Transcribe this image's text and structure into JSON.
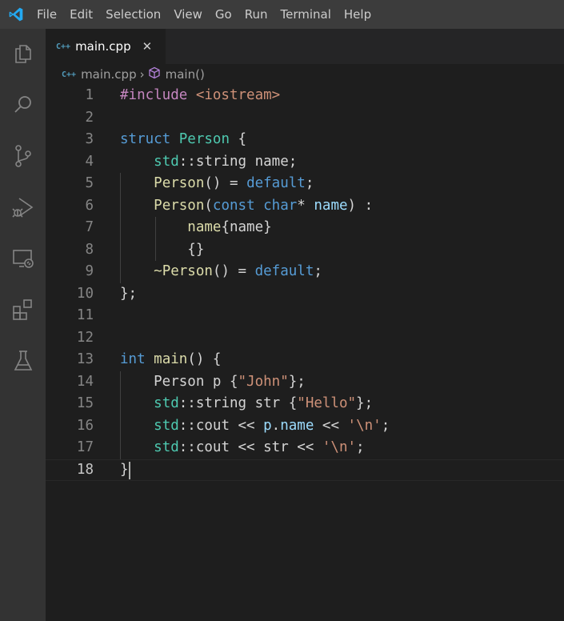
{
  "menu": [
    "File",
    "Edit",
    "Selection",
    "View",
    "Go",
    "Run",
    "Terminal",
    "Help"
  ],
  "tab": {
    "icon_text": "C++",
    "label": "main.cpp",
    "close": "✕"
  },
  "breadcrumb": {
    "icon_text": "C++",
    "file": "main.cpp",
    "separator": "›",
    "symbol": "main()"
  },
  "colors": {
    "accent": "#007acc",
    "type": "#4ec9b0",
    "keyword": "#569cd6",
    "string": "#ce9178"
  },
  "code": [
    {
      "n": "1",
      "tokens": [
        [
          "#include ",
          "kw-purple"
        ],
        [
          "<iostream>",
          "str"
        ]
      ]
    },
    {
      "n": "2",
      "tokens": []
    },
    {
      "n": "3",
      "tokens": [
        [
          "struct ",
          "kw-blue"
        ],
        [
          "Person",
          "type"
        ],
        [
          " {",
          "plain"
        ]
      ]
    },
    {
      "n": "4",
      "tokens": [
        [
          "    ",
          "plain"
        ],
        [
          "std",
          "type"
        ],
        [
          "::string name;",
          "plain"
        ]
      ]
    },
    {
      "n": "5",
      "tokens": [
        [
          "    ",
          "plain"
        ],
        [
          "Person",
          "fn"
        ],
        [
          "() = ",
          "plain"
        ],
        [
          "default",
          "kw-blue"
        ],
        [
          ";",
          "plain"
        ]
      ]
    },
    {
      "n": "6",
      "tokens": [
        [
          "    ",
          "plain"
        ],
        [
          "Person",
          "fn"
        ],
        [
          "(",
          "plain"
        ],
        [
          "const ",
          "kw-blue"
        ],
        [
          "char",
          "kw-blue"
        ],
        [
          "* ",
          "plain"
        ],
        [
          "name",
          "var"
        ],
        [
          ") :",
          "plain"
        ]
      ]
    },
    {
      "n": "7",
      "tokens": [
        [
          "        ",
          "plain"
        ],
        [
          "name",
          "fn"
        ],
        [
          "{name}",
          "plain"
        ]
      ]
    },
    {
      "n": "8",
      "tokens": [
        [
          "        ",
          "plain"
        ],
        [
          "{}",
          "plain"
        ]
      ]
    },
    {
      "n": "9",
      "tokens": [
        [
          "    ",
          "plain"
        ],
        [
          "~Person",
          "fn"
        ],
        [
          "() = ",
          "plain"
        ],
        [
          "default",
          "kw-blue"
        ],
        [
          ";",
          "plain"
        ]
      ]
    },
    {
      "n": "10",
      "tokens": [
        [
          "};",
          "plain"
        ]
      ]
    },
    {
      "n": "11",
      "tokens": []
    },
    {
      "n": "12",
      "tokens": []
    },
    {
      "n": "13",
      "tokens": [
        [
          "int ",
          "kw-blue"
        ],
        [
          "main",
          "fn"
        ],
        [
          "() {",
          "plain"
        ]
      ]
    },
    {
      "n": "14",
      "tokens": [
        [
          "    Person p {",
          "plain"
        ],
        [
          "\"John\"",
          "str"
        ],
        [
          "};",
          "plain"
        ]
      ]
    },
    {
      "n": "15",
      "tokens": [
        [
          "    ",
          "plain"
        ],
        [
          "std",
          "type"
        ],
        [
          "::string str {",
          "plain"
        ],
        [
          "\"Hello\"",
          "str"
        ],
        [
          "};",
          "plain"
        ]
      ]
    },
    {
      "n": "16",
      "tokens": [
        [
          "    ",
          "plain"
        ],
        [
          "std",
          "type"
        ],
        [
          "::cout << ",
          "plain"
        ],
        [
          "p",
          "var"
        ],
        [
          ".",
          "plain"
        ],
        [
          "name",
          "var"
        ],
        [
          " << ",
          "plain"
        ],
        [
          "'\\n'",
          "str"
        ],
        [
          ";",
          "plain"
        ]
      ]
    },
    {
      "n": "17",
      "tokens": [
        [
          "    ",
          "plain"
        ],
        [
          "std",
          "type"
        ],
        [
          "::cout << str << ",
          "plain"
        ],
        [
          "'\\n'",
          "str"
        ],
        [
          ";",
          "plain"
        ]
      ]
    },
    {
      "n": "18",
      "tokens": [
        [
          "}",
          "plain"
        ]
      ]
    }
  ]
}
